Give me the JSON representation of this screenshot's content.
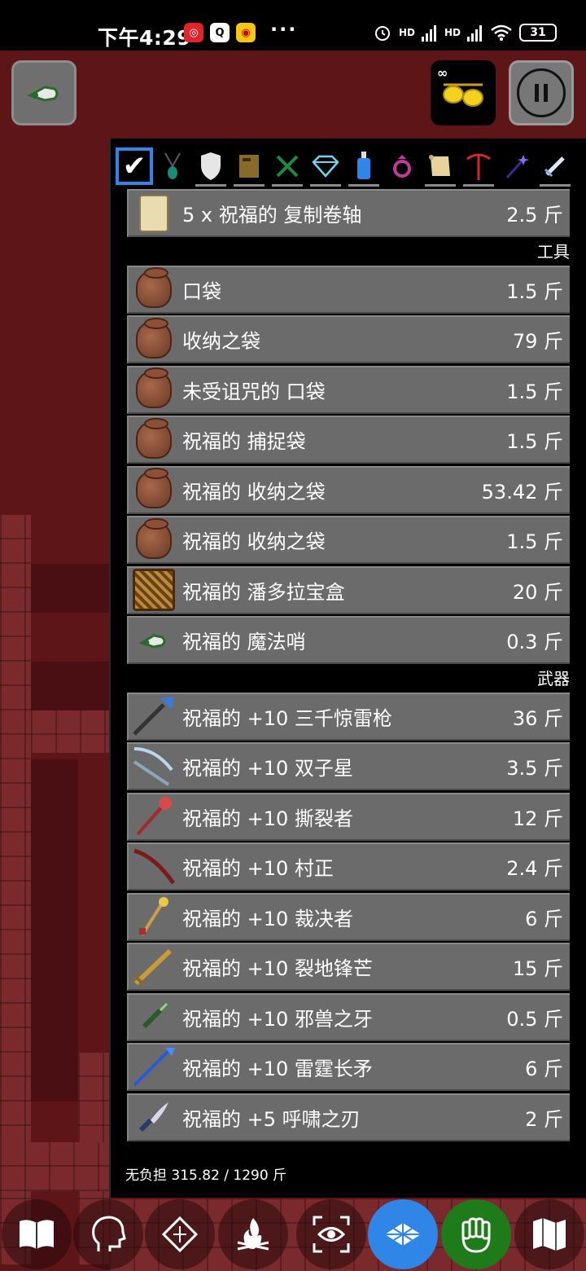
{
  "status_bar": {
    "time": "下午4:29",
    "more": "···",
    "signal1": "HD",
    "signal2": "HD",
    "battery": "31"
  },
  "hud": {
    "whistle": "whistle-icon",
    "glasses": "sunglasses-icon",
    "glasses_mark": "∞",
    "pause": "pause-icon"
  },
  "filters": [
    {
      "name": "all",
      "icon": "checkbox-icon",
      "active": true
    },
    {
      "name": "amulet",
      "icon": "amulet-icon"
    },
    {
      "name": "armor",
      "icon": "shield-icon"
    },
    {
      "name": "book",
      "icon": "book-icon"
    },
    {
      "name": "food",
      "icon": "fork-knife-icon"
    },
    {
      "name": "gem",
      "icon": "gem-icon"
    },
    {
      "name": "potion",
      "icon": "potion-icon"
    },
    {
      "name": "ring",
      "icon": "ring-icon"
    },
    {
      "name": "scroll",
      "icon": "scroll-icon"
    },
    {
      "name": "tool",
      "icon": "pickaxe-icon"
    },
    {
      "name": "wand",
      "icon": "wand-icon"
    },
    {
      "name": "weapon",
      "icon": "sword-icon"
    }
  ],
  "inventory": {
    "first_item": {
      "name": "5 x 祝福的 复制卷轴",
      "weight": "2.5 斤",
      "icon": "scroll-icon"
    },
    "tools_header": "工具",
    "tools": [
      {
        "name": "口袋",
        "weight": "1.5 斤",
        "icon": "bag-icon"
      },
      {
        "name": "收纳之袋",
        "weight": "79 斤",
        "icon": "bag-icon"
      },
      {
        "name": "未受诅咒的 口袋",
        "weight": "1.5 斤",
        "icon": "bag-icon"
      },
      {
        "name": "祝福的 捕捉袋",
        "weight": "1.5 斤",
        "icon": "bag-icon"
      },
      {
        "name": "祝福的 收纳之袋",
        "weight": "53.42 斤",
        "icon": "bag-icon"
      },
      {
        "name": "祝福的 收纳之袋",
        "weight": "1.5 斤",
        "icon": "bag-icon"
      },
      {
        "name": "祝福的 潘多拉宝盒",
        "weight": "20 斤",
        "icon": "puzzle-box-icon"
      },
      {
        "name": "祝福的 魔法哨",
        "weight": "0.3 斤",
        "icon": "whistle-icon"
      }
    ],
    "weapons_header": "武器",
    "weapons": [
      {
        "name": "祝福的 +10 三千惊雷枪",
        "weight": "36 斤",
        "icon": "lance-icon"
      },
      {
        "name": "祝福的 +10 双子星",
        "weight": "3.5 斤",
        "icon": "crossbow-icon"
      },
      {
        "name": "祝福的 +10 撕裂者",
        "weight": "12 斤",
        "icon": "axe-icon"
      },
      {
        "name": "祝福的 +10 村正",
        "weight": "2.4 斤",
        "icon": "katana-icon"
      },
      {
        "name": "祝福的 +10 裁决者",
        "weight": "6 斤",
        "icon": "mace-icon"
      },
      {
        "name": "祝福的 +10 裂地锋芒",
        "weight": "15 斤",
        "icon": "greatsword-icon"
      },
      {
        "name": "祝福的 +10 邪兽之牙",
        "weight": "0.5 斤",
        "icon": "dagger-icon"
      },
      {
        "name": "祝福的 +10 雷霆长矛",
        "weight": "6 斤",
        "icon": "spear-icon"
      },
      {
        "name": "祝福的 +5 呼啸之刃",
        "weight": "2 斤",
        "icon": "knife-icon"
      }
    ],
    "encumbrance": "无负担 315.82 / 1290 斤"
  },
  "action_bar": [
    {
      "name": "spellbook",
      "icon": "book-icon"
    },
    {
      "name": "character",
      "icon": "head-icon"
    },
    {
      "name": "abilities",
      "icon": "sigil-icon"
    },
    {
      "name": "rest",
      "icon": "campfire-icon"
    },
    {
      "name": "look",
      "icon": "eye-icon"
    },
    {
      "name": "inventory",
      "icon": "inventory-grid-icon",
      "active": true
    },
    {
      "name": "hand",
      "icon": "fist-icon"
    },
    {
      "name": "map",
      "icon": "map-icon"
    }
  ],
  "colors": {
    "accent": "#2f86e6",
    "background": "#5b1416",
    "row": "#6b6b6b",
    "green": "#1f7a1a"
  }
}
